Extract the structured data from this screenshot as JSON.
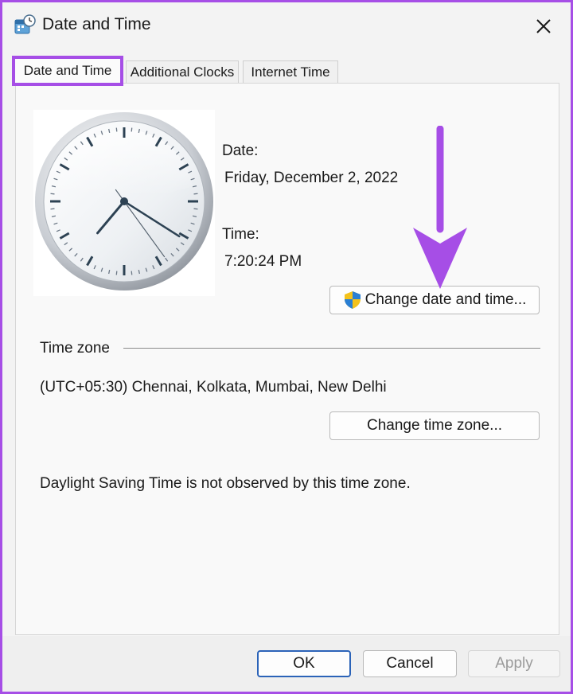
{
  "window": {
    "title": "Date and Time",
    "app_icon": "calendar-clock-icon",
    "close_icon": "close-icon"
  },
  "tabs": [
    {
      "label": "Date and Time",
      "active": true
    },
    {
      "label": "Additional Clocks",
      "active": false
    },
    {
      "label": "Internet Time",
      "active": false
    }
  ],
  "datetime": {
    "date_label": "Date:",
    "date_value": "Friday, December 2, 2022",
    "time_label": "Time:",
    "time_value": "7:20:24 PM",
    "change_button": "Change date and time...",
    "change_button_icon": "uac-shield-icon"
  },
  "timezone": {
    "heading": "Time zone",
    "value": "(UTC+05:30) Chennai, Kolkata, Mumbai, New Delhi",
    "change_button": "Change time zone...",
    "dst_note": "Daylight Saving Time is not observed by this time zone."
  },
  "footer": {
    "ok_label": "OK",
    "cancel_label": "Cancel",
    "apply_label": "Apply"
  },
  "annotation": {
    "highlight_color": "#a64ee6",
    "arrow_color": "#a64ee6"
  }
}
